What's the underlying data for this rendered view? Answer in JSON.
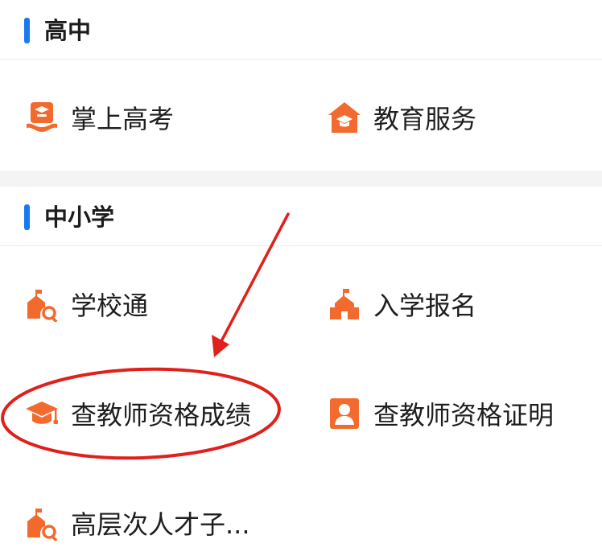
{
  "sections": [
    {
      "title": "高中",
      "items": [
        {
          "label": "掌上高考",
          "icon": "exam-hand-icon"
        },
        {
          "label": "教育服务",
          "icon": "school-house-icon"
        }
      ]
    },
    {
      "title": "中小学",
      "items": [
        {
          "label": "学校通",
          "icon": "school-search-icon"
        },
        {
          "label": "入学报名",
          "icon": "school-building-icon"
        },
        {
          "label": "查教师资格成绩",
          "icon": "graduation-cap-icon"
        },
        {
          "label": "查教师资格证明",
          "icon": "person-card-icon"
        },
        {
          "label": "高层次人才子...",
          "icon": "school-search-icon"
        }
      ]
    }
  ],
  "colors": {
    "accent_blue": "#1b79f0",
    "icon_orange": "#f26a2e",
    "annotation_red": "#e0201b"
  }
}
